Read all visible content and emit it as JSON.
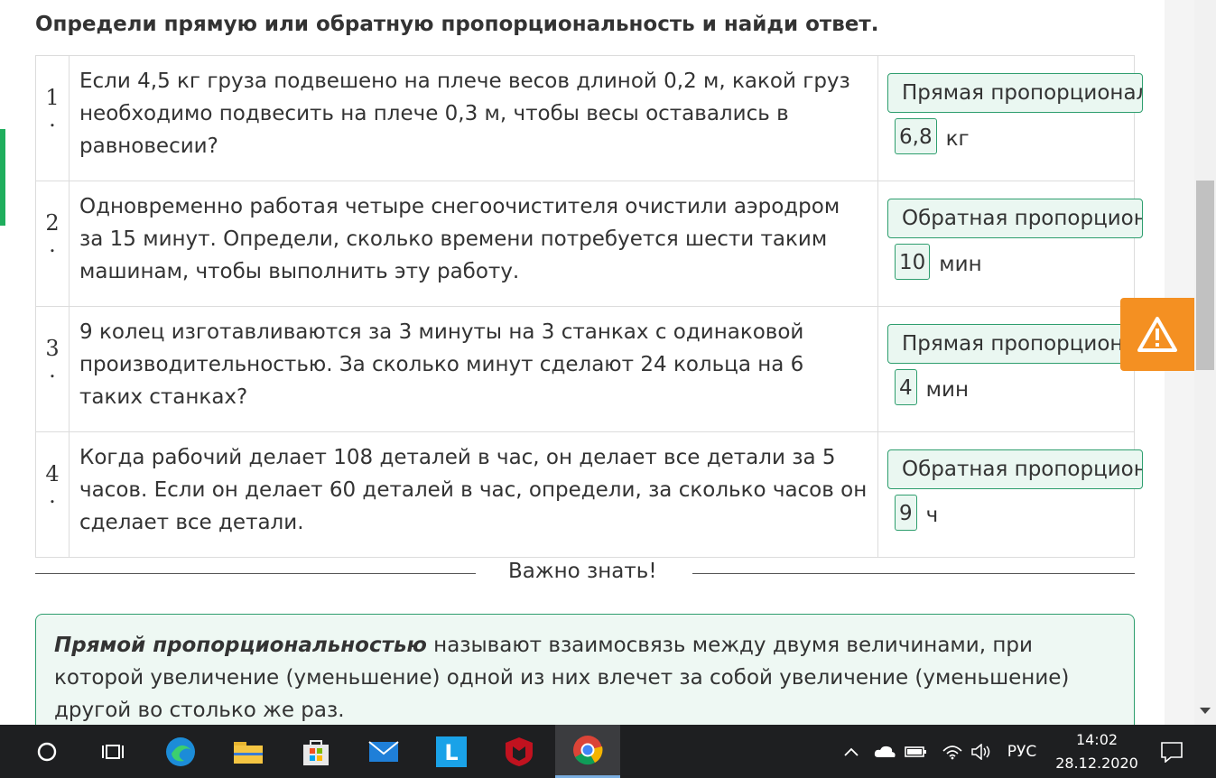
{
  "heading": "Определи прямую или обратную пропорциональность и найди ответ.",
  "tasks": [
    {
      "num": "1",
      "dot": ".",
      "question": "Если 4,5 кг груза подвешено на плече весов длиной 0,2 м, какой груз необходимо подвесить на плече 0,3 м, чтобы весы оставались в равновесии?",
      "selection": "Прямая пропорциональность",
      "answer": "6,8",
      "unit": "кг"
    },
    {
      "num": "2",
      "dot": ".",
      "question": "Одновременно работая четыре снегоочистителя очистили аэродром за 15 минут. Определи, сколько времени потребуется шести таким машинам, чтобы выполнить эту работу.",
      "selection": "Обратная пропорциональность",
      "answer": "10",
      "unit": "мин"
    },
    {
      "num": "3",
      "dot": ".",
      "question": "9 колец изготавливаются за 3 минуты на 3 станках с одинаковой производительностью. За сколько минут сделают 24 кольца на 6 таких станках?",
      "selection": "Прямая пропорциональность",
      "answer": "4",
      "unit": "мин"
    },
    {
      "num": "4",
      "dot": ".",
      "question": "Когда рабочий делает 108 деталей в час, он делает все детали за 5 часов. Если он делает 60 деталей в час, определи, за сколько часов он сделает все детали.",
      "selection": "Обратная пропорциональность",
      "answer": "9",
      "unit": "ч"
    }
  ],
  "important_title": "Важно знать!",
  "info": {
    "term": "Прямой пропорциональностью",
    "text": " называют взаимосвязь между двумя величинами, при которой увеличение (уменьшение) одной из них влечет за собой увеличение (уменьшение) другой во столько же раз."
  },
  "taskbar": {
    "language": "РУС",
    "time": "14:02",
    "date": "28.12.2020"
  },
  "colors": {
    "accent": "#2e9e6e",
    "warning": "#f49022",
    "taskbar": "#1e1f21"
  }
}
